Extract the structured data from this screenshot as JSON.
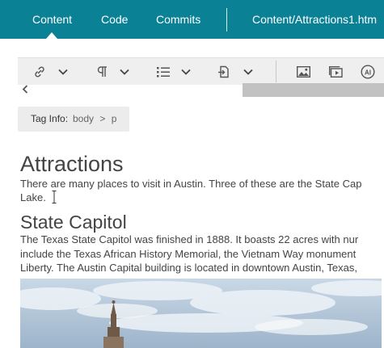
{
  "nav": {
    "tabs": [
      {
        "label": "Content",
        "active": true
      },
      {
        "label": "Code",
        "active": false
      },
      {
        "label": "Commits",
        "active": false
      }
    ],
    "path": "Content/Attractions1.htm"
  },
  "toolbar": {
    "items": [
      "link-icon",
      "paragraph-icon",
      "list-icon",
      "insert-file-icon",
      "image-icon",
      "media-icon",
      "ai-assistant-icon"
    ],
    "ai_label": "AI"
  },
  "tag_info": {
    "label": "Tag Info:",
    "crumbs": [
      "body",
      "p"
    ],
    "separator": ">"
  },
  "document": {
    "heading1": "Attractions",
    "para1": [
      "There are many places to visit in Austin. Three of these are the State Cap",
      "Lake."
    ],
    "heading2": "State Capitol",
    "para2": [
      "The Texas State Capitol was finished in 1888. It boasts 22 acres with nur",
      "include the Texas African History Memorial, the Vietnam Way monument",
      "Liberty. The Austin Capital building is located in downtown Austin, Texas,"
    ]
  },
  "colors": {
    "nav_bg": "#0b8196",
    "toolbar_bg": "#efefef",
    "taginfo_bg": "#ececec"
  }
}
